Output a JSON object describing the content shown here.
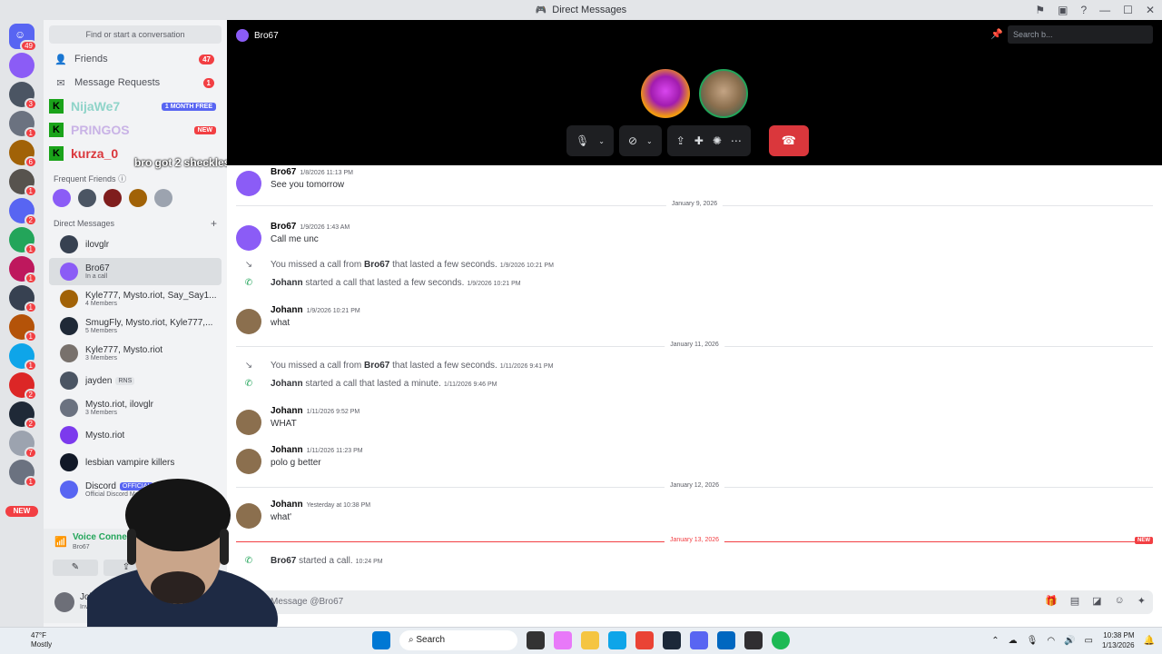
{
  "window": {
    "title": "Direct Messages"
  },
  "rail": {
    "home_badge": "49",
    "servers": [
      {
        "badge": "",
        "color": "#8b5cf6"
      },
      {
        "badge": "3",
        "color": "#4b5563"
      },
      {
        "badge": "1",
        "color": "#6b7280"
      },
      {
        "badge": "6",
        "color": "#a16207"
      },
      {
        "badge": "1",
        "color": "#57534e"
      },
      {
        "badge": "2",
        "color": "#5865f2"
      },
      {
        "badge": "1",
        "color": "#23a55a"
      },
      {
        "badge": "1",
        "color": "#be185d"
      },
      {
        "badge": "1",
        "color": "#374151"
      },
      {
        "badge": "1",
        "color": "#b45309"
      },
      {
        "badge": "1",
        "color": "#0ea5e9"
      },
      {
        "badge": "2",
        "color": "#dc2626"
      },
      {
        "badge": "2",
        "color": "#1f2937"
      },
      {
        "badge": "7",
        "color": "#9ca3af"
      },
      {
        "badge": "1",
        "color": "#6b7280"
      }
    ],
    "new_label": "NEW"
  },
  "sidebar": {
    "search_label": "Find or start a conversation",
    "friends_label": "Friends",
    "friends_count": "47",
    "requests_label": "Message Requests",
    "requests_count": "1",
    "promos": [
      {
        "name": "NijaWe7",
        "tag": "1 MONTH FREE",
        "tag_color": "#5865f2",
        "name_color": "#8fd4c9"
      },
      {
        "name": "PRINGOS",
        "tag": "NEW",
        "tag_color": "#f23f43",
        "name_color": "#c9b3e6"
      },
      {
        "name": "kurza_0",
        "tag": "",
        "tag_color": "",
        "name_color": "#da373c"
      }
    ],
    "promo_overlay_text": "bro got 2 sheckles",
    "frequent_friends_label": "Frequent Friends",
    "direct_messages_label": "Direct Messages",
    "dms": [
      {
        "name": "ilovglr",
        "sub": "",
        "tag": "",
        "color": "#374151"
      },
      {
        "name": "Bro67",
        "sub": "In a call",
        "tag": "",
        "color": "#8b5cf6"
      },
      {
        "name": "Kyle777, Mysto.riot, Say_Say1...",
        "sub": "4 Members",
        "tag": "",
        "color": "#a16207"
      },
      {
        "name": "SmugFly, Mysto.riot, Kyle777,...",
        "sub": "5 Members",
        "tag": "",
        "color": "#1f2937"
      },
      {
        "name": "Kyle777, Mysto.riot",
        "sub": "3 Members",
        "tag": "",
        "color": "#78716c"
      },
      {
        "name": "jayden",
        "sub": "",
        "tag": "RNS",
        "color": "#4b5563"
      },
      {
        "name": "Mysto.riot, ilovglr",
        "sub": "3 Members",
        "tag": "",
        "color": "#6b7280"
      },
      {
        "name": "Mysto.riot",
        "sub": "",
        "tag": "",
        "color": "#7c3aed"
      },
      {
        "name": "lesbian vampire killers",
        "sub": "",
        "tag": "",
        "color": "#111827"
      },
      {
        "name": "Discord",
        "sub": "Official Discord Messages",
        "tag": "OFFICIAL",
        "color": "#5865f2"
      }
    ]
  },
  "voice": {
    "status": "Voice Connected",
    "channel": "Bro67"
  },
  "user": {
    "name": "Johann",
    "status": "Invisible"
  },
  "call": {
    "channel_name": "Bro67",
    "search_placeholder": "Search b..."
  },
  "messages": {
    "m1_author": "Bro67",
    "m1_time": "1/8/2026 11:13 PM",
    "m1_text": "See you tomorrow",
    "d1": "January 9, 2026",
    "m2_author": "Bro67",
    "m2_time": "1/9/2026 1:43 AM",
    "m2_text": "Call me unc",
    "s1_pre": "You missed a call from",
    "s1_name": "Bro67",
    "s1_post": "that lasted a few seconds.",
    "s1_time": "1/9/2026 10:21 PM",
    "s2_name": "Johann",
    "s2_post": "started a call that lasted a few seconds.",
    "s2_time": "1/9/2026 10:21 PM",
    "m3_author": "Johann",
    "m3_time": "1/9/2026 10:21 PM",
    "m3_text": "what",
    "d2": "January 11, 2026",
    "s3_pre": "You missed a call from",
    "s3_name": "Bro67",
    "s3_post": "that lasted a few seconds.",
    "s3_time": "1/11/2026 9:41 PM",
    "s4_name": "Johann",
    "s4_post": "started a call that lasted a minute.",
    "s4_time": "1/11/2026 9:46 PM",
    "m4_author": "Johann",
    "m4_time": "1/11/2026 9:52 PM",
    "m4_text": "WHAT",
    "m5_author": "Johann",
    "m5_time": "1/11/2026 11:23 PM",
    "m5_text": "polo g better",
    "d3": "January 12, 2026",
    "m6_author": "Johann",
    "m6_time": "Yesterday at 10:38 PM",
    "m6_text": "what'",
    "d4": "January 13, 2026",
    "new_pill": "NEW",
    "s5_name": "Bro67",
    "s5_post": "started a call.",
    "s5_time": "10:24 PM"
  },
  "composer": {
    "placeholder": "Message @Bro67"
  },
  "taskbar": {
    "temp": "47°F",
    "weather": "Mostly",
    "search": "Search",
    "time": "10:38 PM",
    "date": "1/13/2026"
  }
}
